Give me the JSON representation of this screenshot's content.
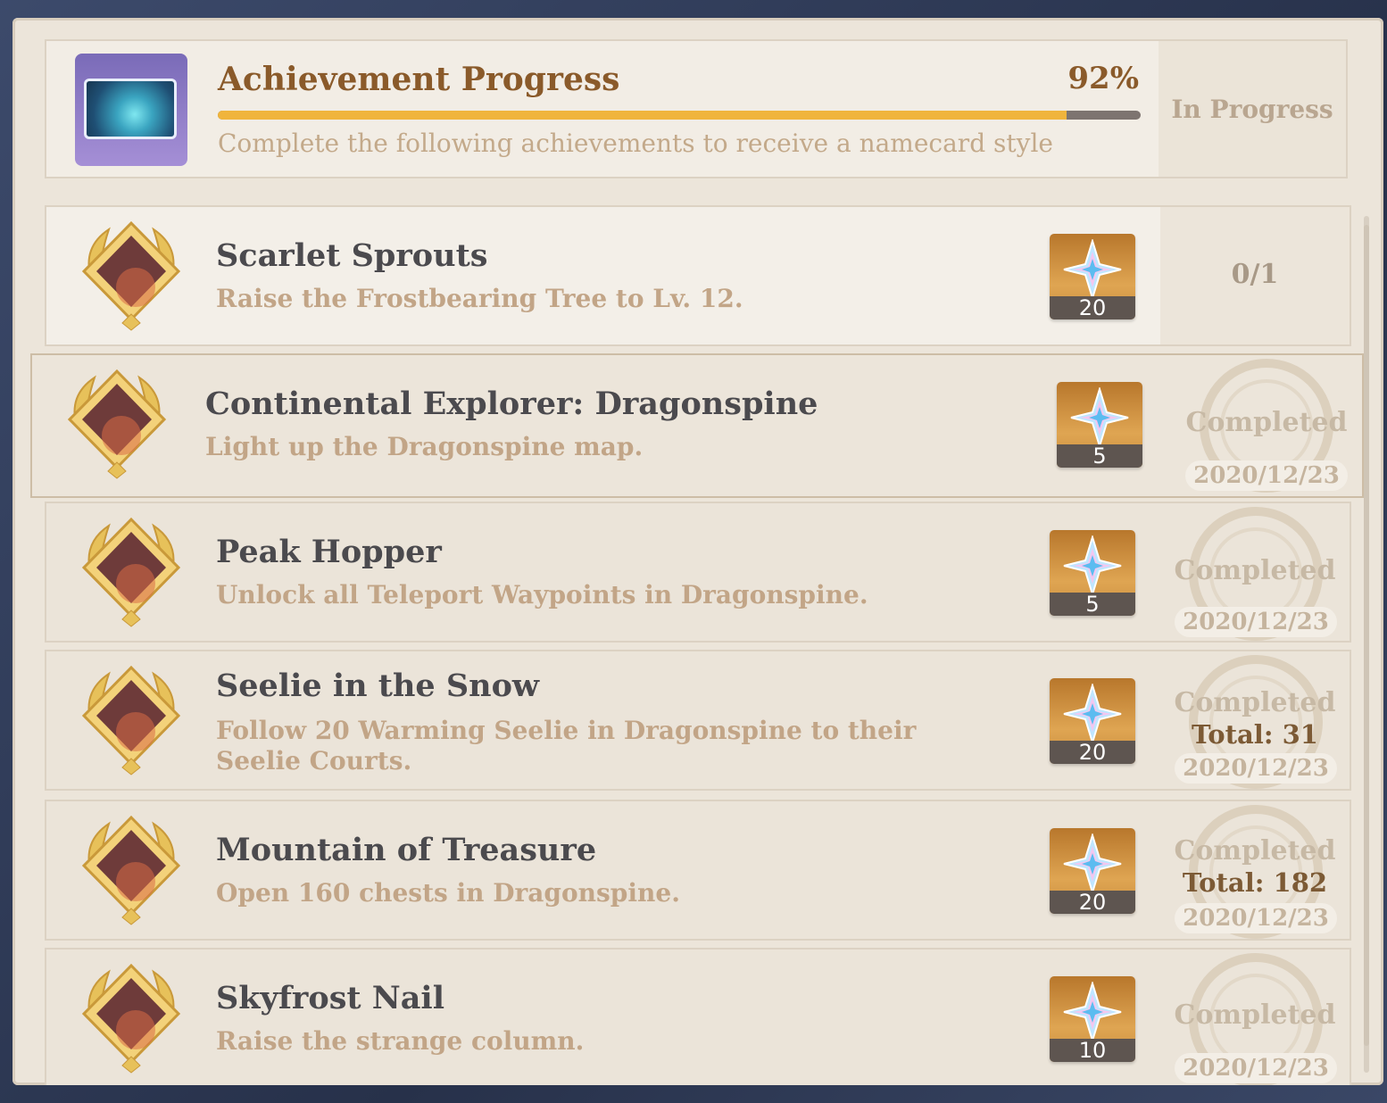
{
  "header": {
    "title": "Achievement Progress",
    "percent_label": "92%",
    "progress": 0.92,
    "description": "Complete the following achievements to receive a namecard style",
    "status": "In Progress"
  },
  "achievements": [
    {
      "name": "Scarlet Sprouts",
      "description": "Raise the Frostbearing Tree to Lv. 12.",
      "reward": "20",
      "stars": 3,
      "progress": "0/1"
    },
    {
      "name": "Continental Explorer: Dragonspine",
      "description": "Light up the Dragonspine map.",
      "reward": "5",
      "stars": 1,
      "status": "Completed",
      "date": "2020/12/23"
    },
    {
      "name": "Peak Hopper",
      "description": "Unlock all Teleport Waypoints in Dragonspine.",
      "reward": "5",
      "stars": 1,
      "status": "Completed",
      "date": "2020/12/23"
    },
    {
      "name": "Seelie in the Snow",
      "description": "Follow 20 Warming Seelie in Dragonspine to their Seelie Courts.",
      "reward": "20",
      "stars": 3,
      "status": "Completed",
      "total": "Total: 31",
      "date": "2020/12/23"
    },
    {
      "name": "Mountain of Treasure",
      "description": "Open 160 chests in Dragonspine.",
      "reward": "20",
      "stars": 3,
      "status": "Completed",
      "total": "Total: 182",
      "date": "2020/12/23"
    },
    {
      "name": "Skyfrost Nail",
      "description": "Raise the strange column.",
      "reward": "10",
      "stars": 1,
      "status": "Completed",
      "date": "2020/12/23"
    }
  ],
  "colors": {
    "accent": "#8a5a2a",
    "progress_fill": "#f0b43c",
    "panel": "#ece5da"
  }
}
